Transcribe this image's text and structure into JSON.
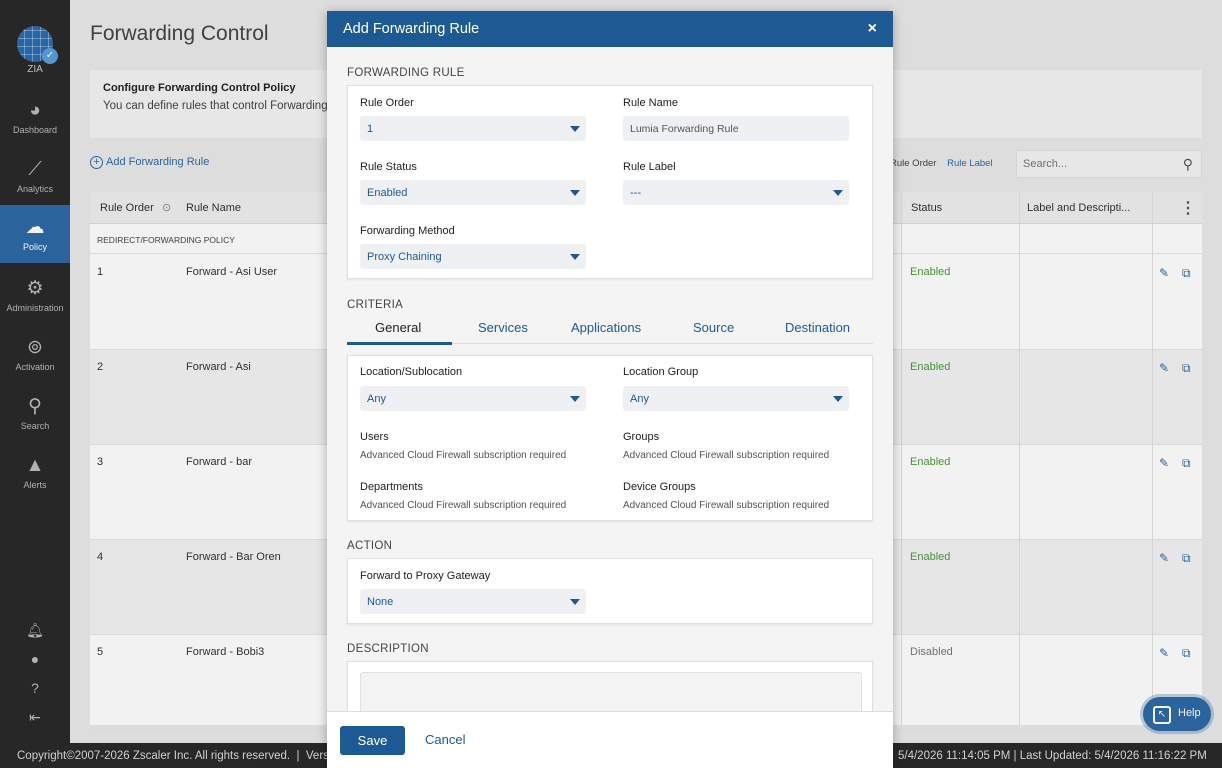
{
  "app": {
    "logo_label": "ZIA"
  },
  "sidebar": {
    "items": [
      {
        "label": "Dashboard",
        "icon": "dashboard-icon"
      },
      {
        "label": "Analytics",
        "icon": "analytics-icon"
      },
      {
        "label": "Policy",
        "icon": "cloud-icon"
      },
      {
        "label": "Administration",
        "icon": "gears-icon"
      },
      {
        "label": "Activation",
        "icon": "activation-icon"
      },
      {
        "label": "Search",
        "icon": "search-icon"
      },
      {
        "label": "Alerts",
        "icon": "alert-icon"
      }
    ]
  },
  "page": {
    "title": "Forwarding Control",
    "policy_heading": "Configure Forwarding Control Policy",
    "policy_desc": "You can define rules that control Forwarding",
    "add_rule": "Add Forwarding Rule",
    "filter_rule_order": "Rule Order",
    "filter_rule_label": "Rule Label",
    "search_placeholder": "Search..."
  },
  "table": {
    "headers": {
      "rule_order": "Rule Order",
      "rule_name": "Rule Name",
      "status": "Status",
      "label_desc": "Label and Descripti..."
    },
    "section": "REDIRECT/FORWARDING POLICY",
    "rows": [
      {
        "order": "1",
        "name": "Forward - Asi User",
        "status": "Enabled"
      },
      {
        "order": "2",
        "name": "Forward - Asi",
        "status": "Enabled"
      },
      {
        "order": "3",
        "name": "Forward - bar",
        "status": "Enabled"
      },
      {
        "order": "4",
        "name": "Forward - Bar Oren",
        "status": "Enabled"
      },
      {
        "order": "5",
        "name": "Forward - Bobi3",
        "status": "Disabled"
      }
    ]
  },
  "footer": {
    "copyright": "Copyright©2007-2026 Zscaler Inc. All rights reserved.",
    "version_fragment": "Versi",
    "timestamps": "5/4/2026 11:14:05 PM  |  Last Updated: 5/4/2026 11:16:22 PM"
  },
  "help": {
    "label": "Help"
  },
  "modal": {
    "title": "Add Forwarding Rule",
    "close": "×",
    "sections": {
      "forwarding_rule": "FORWARDING RULE",
      "criteria": "CRITERIA",
      "action": "ACTION",
      "description": "DESCRIPTION"
    },
    "rule_order": {
      "label": "Rule Order",
      "value": "1"
    },
    "rule_name": {
      "label": "Rule Name",
      "value": "Lumia Forwarding Rule"
    },
    "rule_status": {
      "label": "Rule Status",
      "value": "Enabled"
    },
    "rule_label": {
      "label": "Rule Label",
      "value": "---"
    },
    "forwarding_method": {
      "label": "Forwarding Method",
      "value": "Proxy Chaining"
    },
    "tabs": [
      "General",
      "Services",
      "Applications",
      "Source",
      "Destination"
    ],
    "location": {
      "label": "Location/Sublocation",
      "value": "Any"
    },
    "location_group": {
      "label": "Location Group",
      "value": "Any"
    },
    "users": {
      "label": "Users",
      "note": "Advanced Cloud Firewall subscription required"
    },
    "groups": {
      "label": "Groups",
      "note": "Advanced Cloud Firewall subscription required"
    },
    "departments": {
      "label": "Departments",
      "note": "Advanced Cloud Firewall subscription required"
    },
    "device_groups": {
      "label": "Device Groups",
      "note": "Advanced Cloud Firewall subscription required"
    },
    "proxy_gateway": {
      "label": "Forward to Proxy Gateway",
      "value": "None"
    },
    "save": "Save",
    "cancel": "Cancel"
  },
  "colors": {
    "brand": "#1d5a94",
    "sidebar": "#2a2a2a",
    "enabled": "#4c9a3b"
  }
}
